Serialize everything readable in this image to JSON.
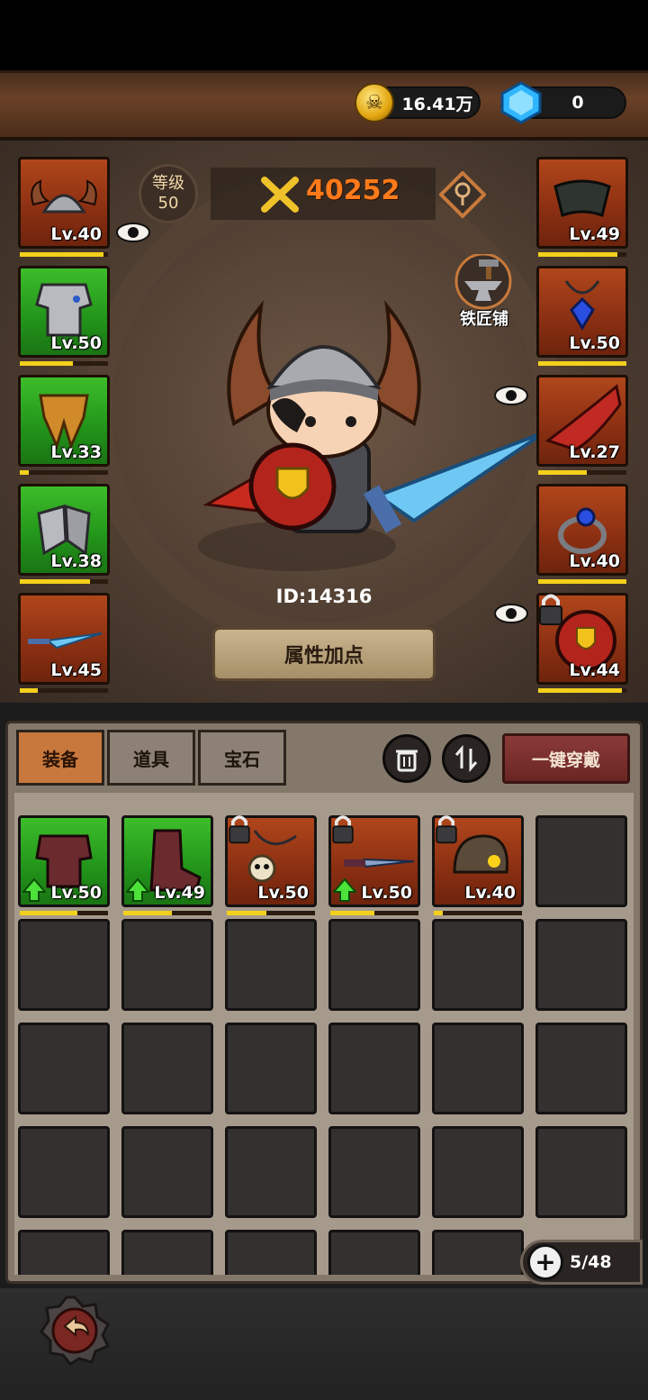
{
  "currency": {
    "coins": "16.41万",
    "gems": "0",
    "coin_icon": "skull-coin-icon",
    "gem_icon": "gem-icon"
  },
  "hero": {
    "level_label": "等级",
    "level_value": "50",
    "power": "40252",
    "id_text": "ID:14316",
    "attr_button": "属性加点",
    "blacksmith_label": "铁匠铺"
  },
  "equipped_left": [
    {
      "name": "horned-helmet",
      "level": "Lv.40",
      "rarity": "red",
      "exp": 0.95
    },
    {
      "name": "steel-chestplate",
      "level": "Lv.50",
      "rarity": "green",
      "exp": 0.6
    },
    {
      "name": "gold-leg-armor",
      "level": "Lv.33",
      "rarity": "green",
      "exp": 0.1
    },
    {
      "name": "steel-gauntlets",
      "level": "Lv.38",
      "rarity": "green",
      "exp": 0.8
    },
    {
      "name": "ice-sword",
      "level": "Lv.45",
      "rarity": "red",
      "exp": 0.2
    }
  ],
  "equipped_right": [
    {
      "name": "shoulder-guard",
      "level": "Lv.49",
      "rarity": "red",
      "exp": 0.9
    },
    {
      "name": "sapphire-amulet",
      "level": "Lv.50",
      "rarity": "red",
      "exp": 1.0
    },
    {
      "name": "red-cape",
      "level": "Lv.27",
      "rarity": "red",
      "exp": 0.55
    },
    {
      "name": "sapphire-ring",
      "level": "Lv.40",
      "rarity": "red",
      "exp": 1.0
    },
    {
      "name": "red-shield",
      "level": "Lv.44",
      "rarity": "red",
      "exp": 0.95
    }
  ],
  "tabs": [
    {
      "label": "装备",
      "active": true
    },
    {
      "label": "道具",
      "active": false
    },
    {
      "label": "宝石",
      "active": false
    }
  ],
  "equip_all_label": "一键穿戴",
  "inventory": [
    {
      "name": "dark-chestplate",
      "level": "Lv.50",
      "rarity": "green",
      "upgrade": true,
      "locked": false,
      "exp": 0.65
    },
    {
      "name": "dark-boots",
      "level": "Lv.49",
      "rarity": "green",
      "upgrade": true,
      "locked": false,
      "exp": 0.55
    },
    {
      "name": "skull-necklace",
      "level": "Lv.50",
      "rarity": "red",
      "upgrade": false,
      "locked": true,
      "exp": 0.45
    },
    {
      "name": "dark-dagger",
      "level": "Lv.50",
      "rarity": "red",
      "upgrade": true,
      "locked": true,
      "exp": 0.5
    },
    {
      "name": "skull-helmet",
      "level": "Lv.40",
      "rarity": "red",
      "upgrade": false,
      "locked": true,
      "exp": 0.1
    }
  ],
  "capacity": "5/48",
  "colors": {
    "power": "#ff7a1a",
    "red_rarity": "#9a3a16",
    "green_rarity": "#27a31f",
    "exp_bar": "#f3d01c"
  }
}
